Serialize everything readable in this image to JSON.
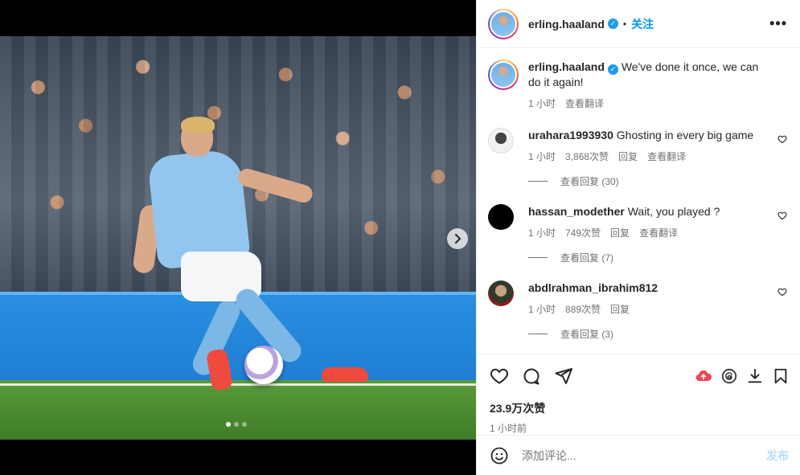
{
  "header": {
    "username": "erling.haaland",
    "dot": "•",
    "follow_label": "关注",
    "more_label": "•••"
  },
  "caption": {
    "username": "erling.haaland",
    "text": "We've done it once, we can do it again!",
    "time": "1 小时",
    "translate": "查看翻译"
  },
  "comments": [
    {
      "username": "urahara1993930",
      "text": "Ghosting in every big game",
      "time": "1 小时",
      "likes": "3,868次赞",
      "reply": "回复",
      "translate": "查看翻译",
      "view_replies": "查看回复 (30)"
    },
    {
      "username": "hassan_modether",
      "text": "Wait, you played ?",
      "time": "1 小时",
      "likes": "749次赞",
      "reply": "回复",
      "translate": "查看翻译",
      "view_replies": "查看回复 (7)"
    },
    {
      "username": "abdlrahman_ibrahim812",
      "text": "",
      "time": "1 小时",
      "likes": "889次赞",
      "reply": "回复",
      "view_replies": "查看回复 (3)"
    }
  ],
  "engagement": {
    "likes": "23.9万次赞",
    "posted": "1 小时前"
  },
  "comment_box": {
    "placeholder": "添加评论...",
    "post_label": "发布"
  },
  "icons": {
    "like": "heart-icon",
    "comment": "comment-icon",
    "share": "share-icon",
    "boost": "cloud-upload-icon",
    "threads": "threads-icon",
    "download": "download-icon",
    "save": "bookmark-icon",
    "emoji": "emoji-icon"
  },
  "colors": {
    "accent": "#0095f6",
    "verified": "#1d9bf0",
    "boost": "#ed4956",
    "muted": "#737373"
  },
  "carousel": {
    "slides": 3,
    "active_slide": 1
  }
}
